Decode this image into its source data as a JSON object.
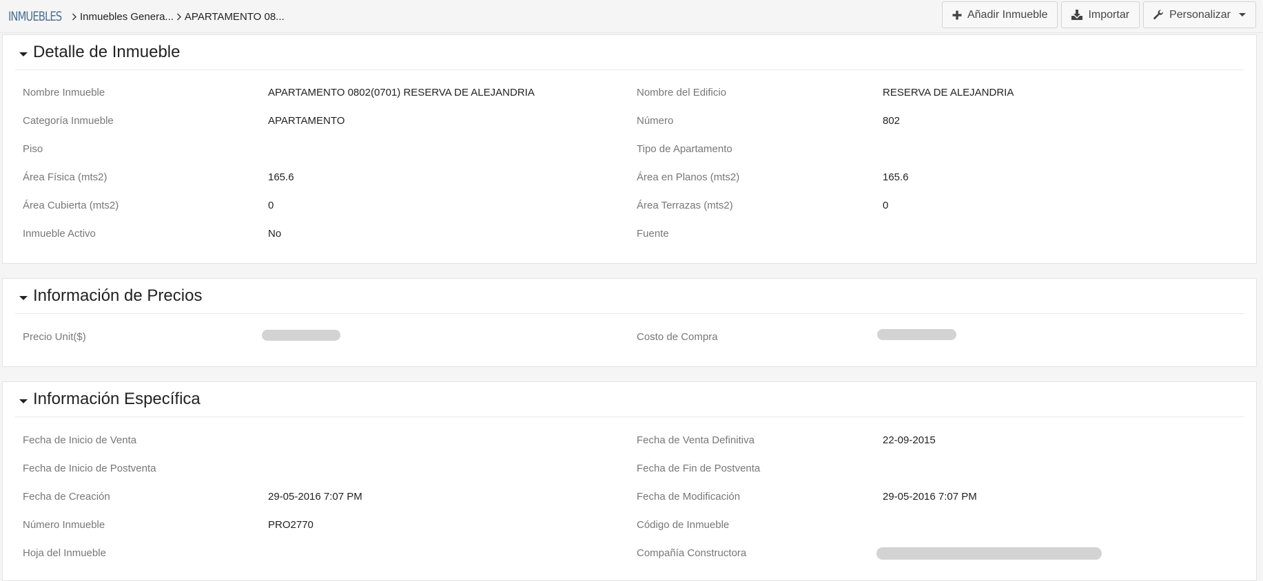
{
  "breadcrumb": {
    "module": "INMUEBLES",
    "items": [
      "Inmuebles Genera...",
      "APARTAMENTO 08..."
    ]
  },
  "actions": {
    "add_label": "Añadir Inmueble",
    "import_label": "Importar",
    "customize_label": "Personalizar"
  },
  "icons": {
    "add": "plus-icon",
    "import": "download-icon",
    "customize": "wrench-icon",
    "collapse": "caret-down-icon"
  },
  "sections": {
    "detalle": {
      "title": "Detalle de Inmueble",
      "fields": {
        "nombre_label": "Nombre Inmueble",
        "nombre_value": "APARTAMENTO 0802(0701) RESERVA DE ALEJANDRIA",
        "edificio_label": "Nombre del Edificio",
        "edificio_value": "RESERVA DE ALEJANDRIA",
        "categoria_label": "Categoría Inmueble",
        "categoria_value": "APARTAMENTO",
        "numero_label": "Número",
        "numero_value": "802",
        "piso_label": "Piso",
        "piso_value": "",
        "tipo_label": "Tipo de Apartamento",
        "tipo_value": "",
        "area_fisica_label": "Área Física (mts2)",
        "area_fisica_value": "165.6",
        "area_planos_label": "Área en Planos (mts2)",
        "area_planos_value": "165.6",
        "area_cubierta_label": "Área Cubierta (mts2)",
        "area_cubierta_value": "0",
        "area_terrazas_label": "Área Terrazas (mts2)",
        "area_terrazas_value": "0",
        "activo_label": "Inmueble Activo",
        "activo_value": "No",
        "fuente_label": "Fuente",
        "fuente_value": ""
      }
    },
    "precios": {
      "title": "Información de Precios",
      "fields": {
        "precio_label": "Precio Unit($)",
        "costo_label": "Costo de Compra"
      }
    },
    "especifica": {
      "title": "Información Específica",
      "fields": {
        "inicio_venta_label": "Fecha de Inicio de Venta",
        "inicio_venta_value": "",
        "venta_def_label": "Fecha de Venta Definitiva",
        "venta_def_value": "22-09-2015",
        "inicio_postventa_label": "Fecha de Inicio de Postventa",
        "inicio_postventa_value": "",
        "fin_postventa_label": "Fecha de Fin de Postventa",
        "fin_postventa_value": "",
        "creacion_label": "Fecha de Creación",
        "creacion_value": "29-05-2016 7:07 PM",
        "modificacion_label": "Fecha de Modificación",
        "modificacion_value": "29-05-2016 7:07 PM",
        "numero_inm_label": "Número Inmueble",
        "numero_inm_value": "PRO2770",
        "codigo_label": "Código de Inmueble",
        "codigo_value": "",
        "hoja_label": "Hoja del Inmueble",
        "hoja_value": "",
        "constructora_label": "Compañía Constructora"
      }
    }
  }
}
